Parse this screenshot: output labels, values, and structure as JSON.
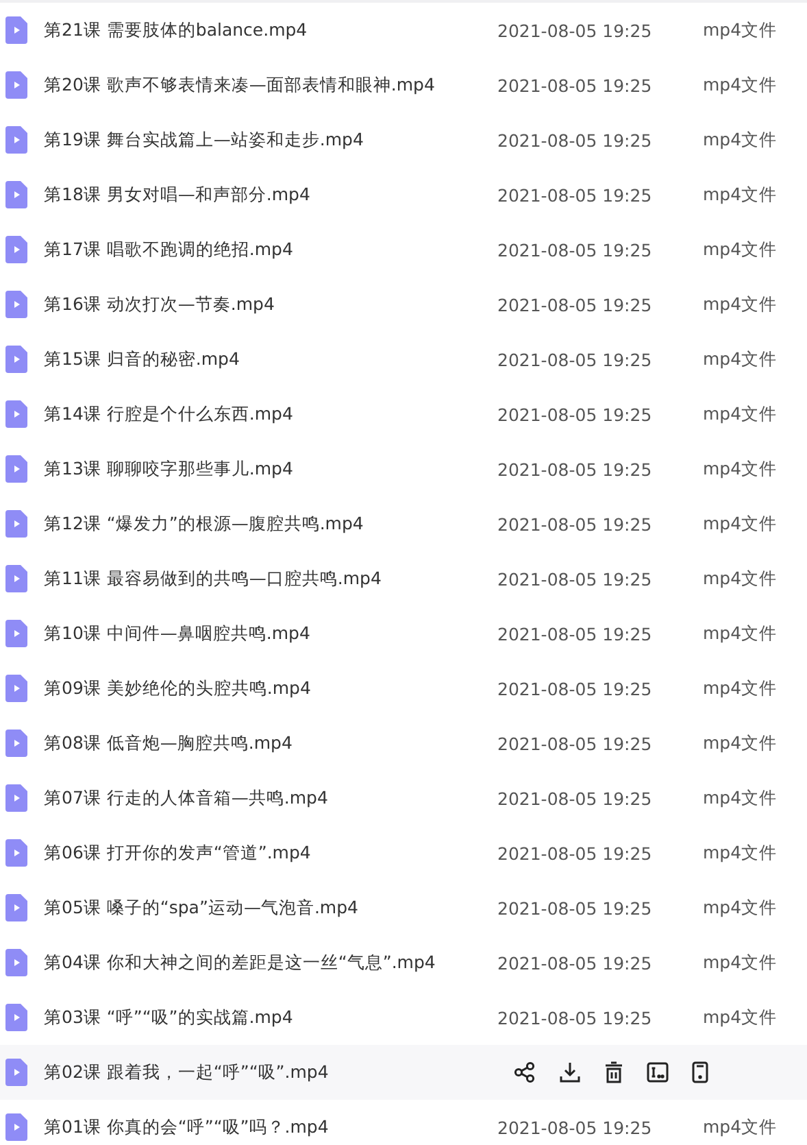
{
  "files": [
    {
      "name": "第21课 需要肢体的balance.mp4",
      "date": "2021-08-05 19:25",
      "type": "mp4文件",
      "hovered": false
    },
    {
      "name": "第20课 歌声不够表情来凑—面部表情和眼神.mp4",
      "date": "2021-08-05 19:25",
      "type": "mp4文件",
      "hovered": false
    },
    {
      "name": "第19课 舞台实战篇上—站姿和走步.mp4",
      "date": "2021-08-05 19:25",
      "type": "mp4文件",
      "hovered": false
    },
    {
      "name": "第18课 男女对唱—和声部分.mp4",
      "date": "2021-08-05 19:25",
      "type": "mp4文件",
      "hovered": false
    },
    {
      "name": "第17课 唱歌不跑调的绝招.mp4",
      "date": "2021-08-05 19:25",
      "type": "mp4文件",
      "hovered": false
    },
    {
      "name": "第16课 动次打次—节奏.mp4",
      "date": "2021-08-05 19:25",
      "type": "mp4文件",
      "hovered": false
    },
    {
      "name": "第15课 归音的秘密.mp4",
      "date": "2021-08-05 19:25",
      "type": "mp4文件",
      "hovered": false
    },
    {
      "name": "第14课 行腔是个什么东西.mp4",
      "date": "2021-08-05 19:25",
      "type": "mp4文件",
      "hovered": false
    },
    {
      "name": "第13课 聊聊咬字那些事儿.mp4",
      "date": "2021-08-05 19:25",
      "type": "mp4文件",
      "hovered": false
    },
    {
      "name": "第12课 “爆发力”的根源—腹腔共鸣.mp4",
      "date": "2021-08-05 19:25",
      "type": "mp4文件",
      "hovered": false
    },
    {
      "name": "第11课 最容易做到的共鸣—口腔共鸣.mp4",
      "date": "2021-08-05 19:25",
      "type": "mp4文件",
      "hovered": false
    },
    {
      "name": "第10课 中间件—鼻咽腔共鸣.mp4",
      "date": "2021-08-05 19:25",
      "type": "mp4文件",
      "hovered": false
    },
    {
      "name": "第09课 美妙绝伦的头腔共鸣.mp4",
      "date": "2021-08-05 19:25",
      "type": "mp4文件",
      "hovered": false
    },
    {
      "name": "第08课 低音炮—胸腔共鸣.mp4",
      "date": "2021-08-05 19:25",
      "type": "mp4文件",
      "hovered": false
    },
    {
      "name": "第07课 行走的人体音箱—共鸣.mp4",
      "date": "2021-08-05 19:25",
      "type": "mp4文件",
      "hovered": false
    },
    {
      "name": "第06课 打开你的发声“管道”.mp4",
      "date": "2021-08-05 19:25",
      "type": "mp4文件",
      "hovered": false
    },
    {
      "name": "第05课 嗓子的“spa”运动—气泡音.mp4",
      "date": "2021-08-05 19:25",
      "type": "mp4文件",
      "hovered": false
    },
    {
      "name": "第04课 你和大神之间的差距是这一丝“气息”.mp4",
      "date": "2021-08-05 19:25",
      "type": "mp4文件",
      "hovered": false
    },
    {
      "name": "第03课 “呼”“吸”的实战篇.mp4",
      "date": "2021-08-05 19:25",
      "type": "mp4文件",
      "hovered": false
    },
    {
      "name": "第02课 跟着我，一起“呼”“吸”.mp4",
      "hovered": true
    },
    {
      "name": "第01课 你真的会“呼”“吸”吗？.mp4",
      "date": "2021-08-05 19:25",
      "type": "mp4文件",
      "hovered": false
    }
  ]
}
